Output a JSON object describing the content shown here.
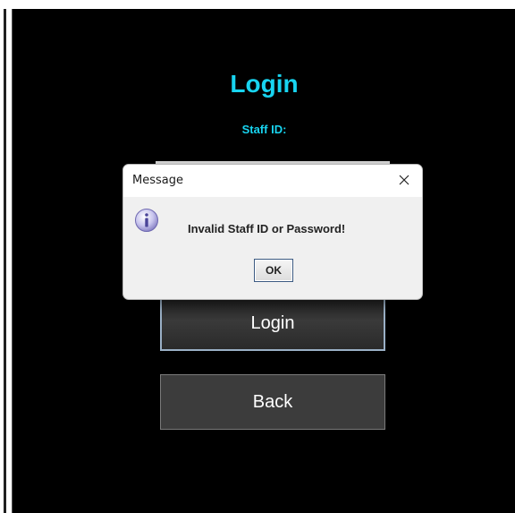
{
  "login_screen": {
    "title": "Login",
    "staff_id_label": "Staff ID:",
    "login_button": "Login",
    "back_button": "Back"
  },
  "dialog": {
    "title": "Message",
    "close_glyph": "✕",
    "icon": "info-icon",
    "message": "Invalid Staff ID or Password!",
    "ok_label": "OK"
  },
  "colors": {
    "title_accent": "#18d4f0",
    "background": "#000000",
    "button_bg": "#3c3c3c",
    "dialog_bg": "#f0f0f0"
  }
}
